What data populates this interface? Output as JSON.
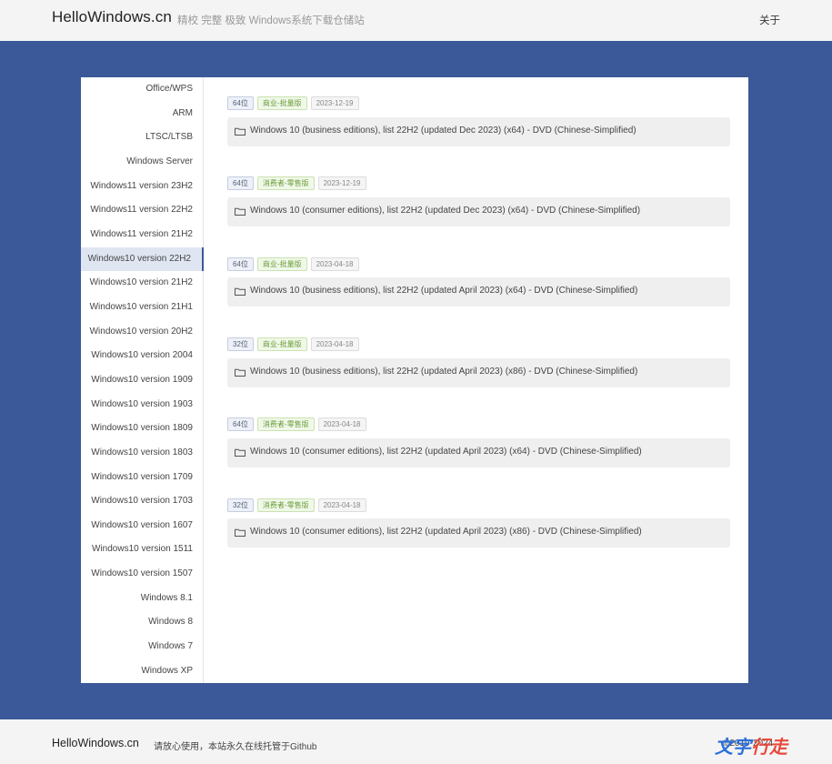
{
  "header": {
    "brand": "HelloWindows.cn",
    "tagline": "精校 完整 极致 Windows系统下载仓储站",
    "about": "关于"
  },
  "sidebar": {
    "items": [
      {
        "label": "Office/WPS",
        "active": false
      },
      {
        "label": "ARM",
        "active": false
      },
      {
        "label": "LTSC/LTSB",
        "active": false
      },
      {
        "label": "Windows Server",
        "active": false
      },
      {
        "label": "Windows11 version 23H2",
        "active": false
      },
      {
        "label": "Windows11 version 22H2",
        "active": false
      },
      {
        "label": "Windows11 version 21H2",
        "active": false
      },
      {
        "label": "Windows10 version 22H2",
        "active": true
      },
      {
        "label": "Windows10 version 21H2",
        "active": false
      },
      {
        "label": "Windows10 version 21H1",
        "active": false
      },
      {
        "label": "Windows10 version 20H2",
        "active": false
      },
      {
        "label": "Windows10 version 2004",
        "active": false
      },
      {
        "label": "Windows10 version 1909",
        "active": false
      },
      {
        "label": "Windows10 version 1903",
        "active": false
      },
      {
        "label": "Windows10 version 1809",
        "active": false
      },
      {
        "label": "Windows10 version 1803",
        "active": false
      },
      {
        "label": "Windows10 version 1709",
        "active": false
      },
      {
        "label": "Windows10 version 1703",
        "active": false
      },
      {
        "label": "Windows10 version 1607",
        "active": false
      },
      {
        "label": "Windows10 version 1511",
        "active": false
      },
      {
        "label": "Windows10 version 1507",
        "active": false
      },
      {
        "label": "Windows 8.1",
        "active": false
      },
      {
        "label": "Windows 8",
        "active": false
      },
      {
        "label": "Windows 7",
        "active": false
      },
      {
        "label": "Windows XP",
        "active": false
      }
    ]
  },
  "entries": [
    {
      "bits": "64位",
      "edition": "商业-批量版",
      "date": "2023-12-19",
      "title": "Windows 10 (business editions), list 22H2 (updated Dec 2023) (x64) - DVD (Chinese-Simplified)",
      "icon": "folder-icon"
    },
    {
      "bits": "64位",
      "edition": "消费者-零售版",
      "date": "2023-12-19",
      "title": "Windows 10 (consumer editions), list 22H2 (updated Dec 2023) (x64) - DVD (Chinese-Simplified)",
      "icon": "folder-icon"
    },
    {
      "bits": "64位",
      "edition": "商业-批量版",
      "date": "2023-04-18",
      "title": "Windows 10 (business editions), list 22H2 (updated April 2023) (x64) - DVD (Chinese-Simplified)",
      "icon": "folder-icon"
    },
    {
      "bits": "32位",
      "edition": "商业-批量版",
      "date": "2023-04-18",
      "title": "Windows 10 (business editions), list 22H2 (updated April 2023) (x86) - DVD (Chinese-Simplified)",
      "icon": "folder-icon"
    },
    {
      "bits": "64位",
      "edition": "消费者-零售版",
      "date": "2023-04-18",
      "title": "Windows 10 (consumer editions), list 22H2 (updated April 2023) (x64) - DVD (Chinese-Simplified)",
      "icon": "folder-icon"
    },
    {
      "bits": "32位",
      "edition": "消费者-零售版",
      "date": "2023-04-18",
      "title": "Windows 10 (consumer editions), list 22H2 (updated April 2023) (x86) - DVD (Chinese-Simplified)",
      "icon": "folder-icon"
    }
  ],
  "footer": {
    "brand": "HelloWindows.cn",
    "note": "请放心使用，本站永久在线托管于Github",
    "copyright": "©2019-2024",
    "watermark_part1": "文字",
    "watermark_part2": "行走"
  },
  "colors": {
    "background": "#3b5998",
    "active_item": "#dfe6f2",
    "bits_tag": "#55607a",
    "edition_tag": "#6a9c3a"
  }
}
